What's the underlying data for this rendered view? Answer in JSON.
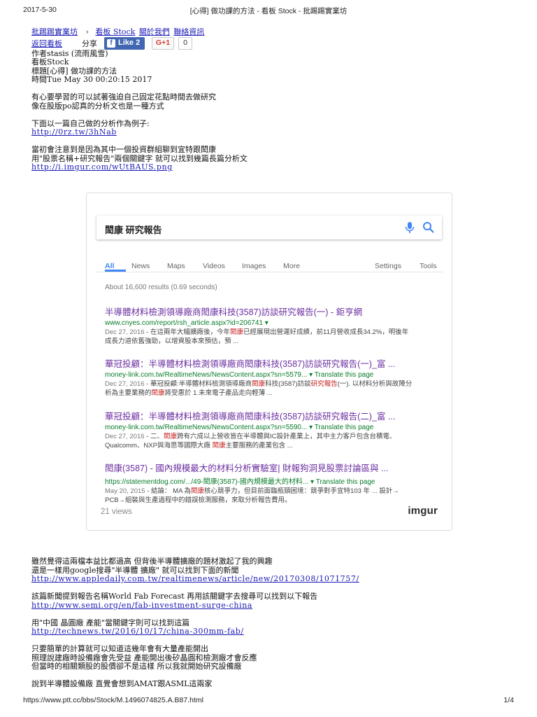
{
  "print_header": {
    "date": "2017-5-30",
    "title": "[心得] 做功課的方法 - 看板 Stock - 批踢踢實業坊"
  },
  "print_footer": {
    "url": "https://www.ptt.cc/bbs/Stock/M.1496074825.A.B87.html",
    "page": "1/4"
  },
  "breadcrumb": {
    "site": "批踢踢實業坊",
    "sep": "›",
    "board": "看板 Stock",
    "about": "關於我們",
    "contact": "聯絡資訊"
  },
  "share": {
    "back": "返回看板",
    "share_label": "分享",
    "fb_like": "Like 2",
    "gplus": "G+1",
    "gplus_count": "0"
  },
  "meta": {
    "author": "作者stasis (流雨風雪)",
    "board": "看板Stock",
    "title": "標題[心得] 做功課的方法",
    "time": "時間Tue May 30 00:20:15 2017"
  },
  "body1": {
    "p1": "有心要學習的可以試著強迫自己固定花點時間去做研究",
    "p2": "像在股版po認真的分析文也是一種方式",
    "p3": "下面以一篇自己做的分析作為例子:",
    "link1": "http://0rz.tw/3hNab",
    "p4": "當初會注意到是因為其中一個投資群組聊到宜特跟閎康",
    "p5": "用\"股票名稱+研究報告\"兩個關鍵字 就可以找到幾篇長篇分析文",
    "link2": "http://i.imgur.com/wUtBAUS.png"
  },
  "embed": {
    "query": "閎康 研究報告",
    "tabs": [
      "All",
      "News",
      "Maps",
      "Videos",
      "Images",
      "More",
      "Settings",
      "Tools"
    ],
    "stats": "About 16,600 results (0.69 seconds)",
    "results": [
      {
        "title": "半導體材料檢測領導廠商閎康科技(3587)訪談研究報告(一) - 鉅亨網",
        "url": "www.cnyes.com/report/rsh_article.aspx?id=206741 ▾",
        "date": "Dec 27, 2016",
        "snippet1": " - 在這兩年大幅擴廠後，今年閎康已經展現出營運好成績，前11月營收成長34.2%，明後年",
        "snippet2": "成長力道依舊強勁，以增資股本來預估，預 ..."
      },
      {
        "title": "華冠投顧：半導體材料檢測領導廠商閎康科技(3587)訪談研究報告(一)_富 ...",
        "url": "money-link.com.tw/RealtimeNews/NewsContent.aspx?sn=5579... ▾ Translate this page",
        "date": "Dec 27, 2016",
        "snippet1": " - 華冠投顧:半導體材料檢測領導廠商閎康科技(3587)訪談研究報告(一). 以材料分析與故障分",
        "snippet2": "析為主要業務的閎康將受惠於 1.未來電子產品走向輕薄 ..."
      },
      {
        "title": "華冠投顧：半導體材料檢測領導廠商閎康科技(3587)訪談研究報告(二)_富 ...",
        "url": "money-link.com.tw/RealtimeNews/NewsContent.aspx?sn=5590... ▾ Translate this page",
        "date": "Dec 27, 2016",
        "snippet1": " - 二、閎康跨有六成以上營收皆在半導體與IC設計產業上，其中主力客戶包含台積電、",
        "snippet2": "Qualcomm、NXP與海思等國際大廠 閎康主要服務的產業包含 ..."
      },
      {
        "title": "閎康(3587) - 國內規模最大的材料分析實驗室| 財報狗洞見股票討論區與 ...",
        "url": "https://statementdog.com/.../49-閎康(3587)-國內規模最大的材料... ▾ Translate this page",
        "date": "May 20, 2015",
        "snippet1": " - 結論： MA 為閎康核心競爭力，但目前面臨瓶頸困境：競爭對手宜特103 年 ... 設計→",
        "snippet2": "PCB→組裝與生產過程中的錯誤檢測服務，來取分析報告費用。"
      }
    ],
    "views": "21 views",
    "brand": "imgur"
  },
  "body2": {
    "p1": "雖然覺得這兩檔本益比都過高 但背後半導體擴廠的題材激起了我的興趣",
    "p2": "還是一樣用google搜尋\"半導體 擴廠\" 就可以找到下面的新聞",
    "link3": "http://www.appledaily.com.tw/realtimenews/article/new/20170308/1071757/",
    "p3": "該篇新聞提到報告名稱World Fab Forecast 再用該關鍵字去搜尋可以找到以下報告",
    "link4": "http://www.semi.org/en/fab-investment-surge-china",
    "p4": "用\"中國 晶圓廠 產能\"當關鍵字則可以找到這篇",
    "link5": "http://technews.tw/2016/10/17/china-300mm-fab/",
    "p5": "只要簡單的計算就可以知道這幾年會有大量產能開出",
    "p6": "照理說建廠時設備廠會先受益 產能開出後矽晶圓和檢測廠才會反應",
    "p7": "但當時的相關類股的股價卻不是這樣 所以我就開始研究設備廠",
    "p8": "說到半導體設備廠 直覺會想到AMAT跟ASML這兩家"
  }
}
